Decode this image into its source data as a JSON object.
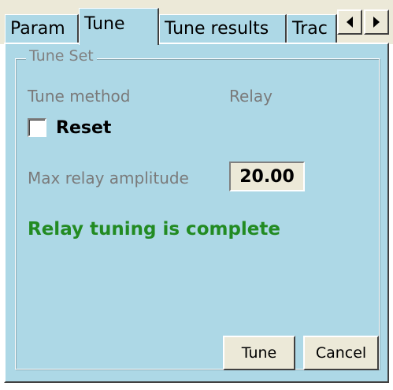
{
  "tabs": [
    {
      "label": "Param"
    },
    {
      "label": "Tune",
      "active": true
    },
    {
      "label": "Tune results"
    },
    {
      "label": "Trac"
    }
  ],
  "tab_scroll": {
    "left_icon": "triangle-left-icon",
    "right_icon": "triangle-right-icon"
  },
  "group": {
    "title": "Tune Set"
  },
  "tune_method": {
    "label": "Tune method",
    "value": "Relay"
  },
  "reset": {
    "label": "Reset",
    "checked": false
  },
  "max_relay": {
    "label": "Max relay amplitude",
    "value": "20.00"
  },
  "status": {
    "text": "Relay tuning is complete",
    "color": "#228b22"
  },
  "buttons": {
    "tune": "Tune",
    "cancel": "Cancel"
  },
  "colors": {
    "panel": "#add8e6",
    "chrome": "#ece9d8"
  }
}
